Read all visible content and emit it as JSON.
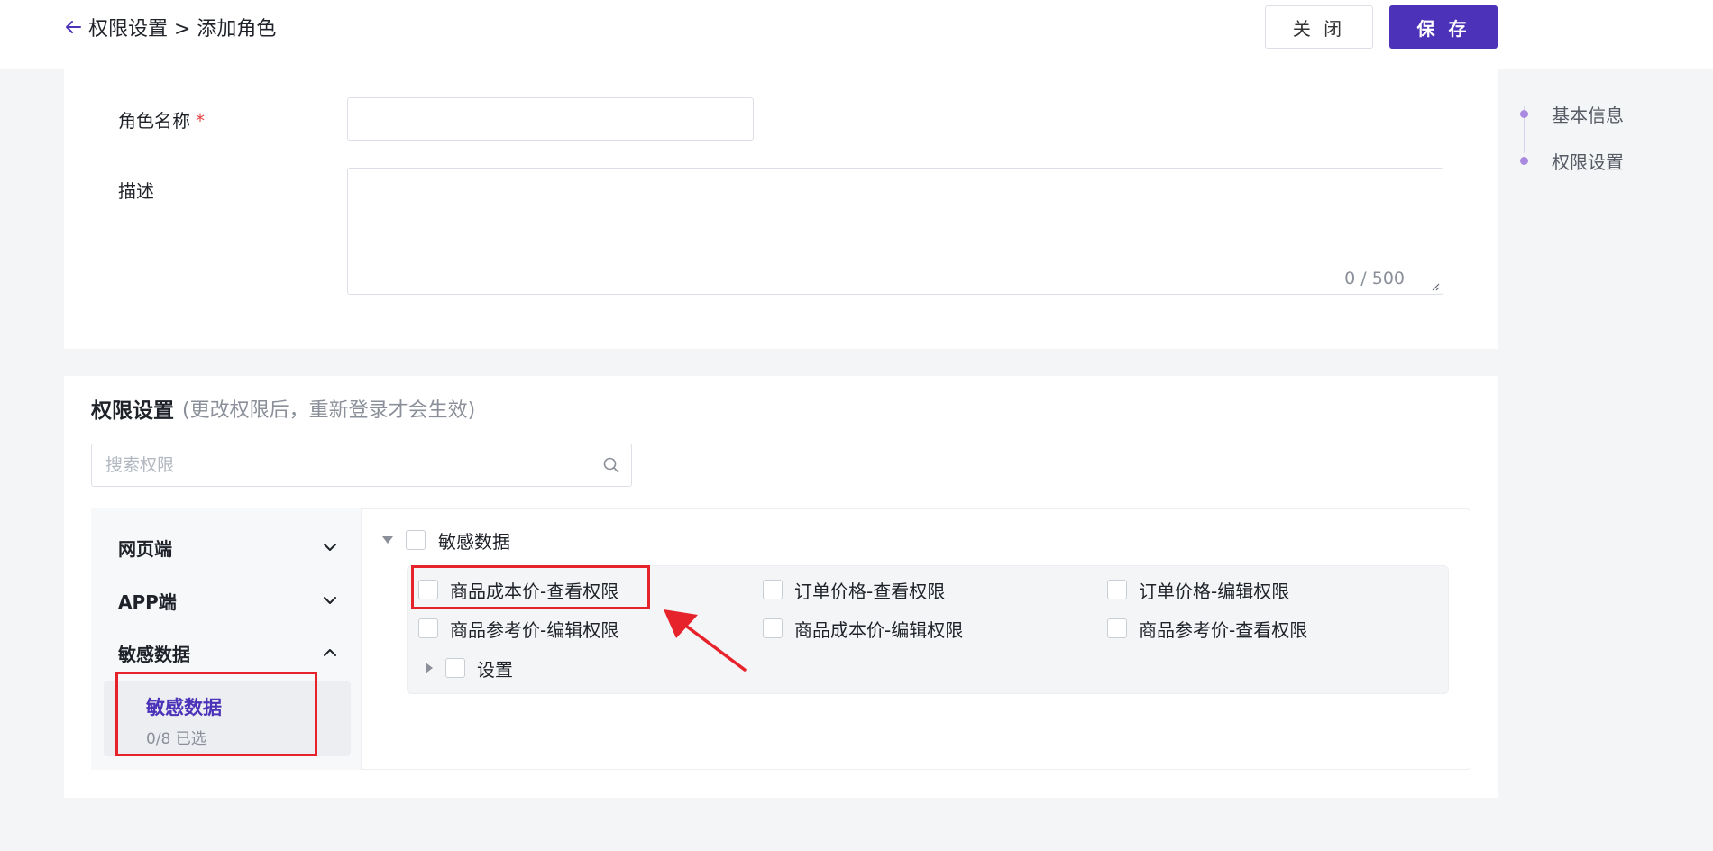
{
  "header": {
    "breadcrumb": "权限设置 > 添加角色",
    "close_label": "关 闭",
    "save_label": "保 存"
  },
  "basic": {
    "name_label": "角色名称",
    "required_mark": "*",
    "name_value": "",
    "desc_label": "描述",
    "desc_value": "",
    "desc_counter": "0 / 500"
  },
  "anchors": [
    "基本信息",
    "权限设置"
  ],
  "permissions": {
    "title": "权限设置",
    "hint": "(更改权限后，重新登录才会生效)",
    "search_placeholder": "搜索权限",
    "sidebar": {
      "groups": [
        {
          "label": "网页端",
          "expanded": false,
          "icon": "chevron-down-icon"
        },
        {
          "label": "APP端",
          "expanded": false,
          "icon": "chevron-down-icon"
        },
        {
          "label": "敏感数据",
          "expanded": true,
          "icon": "chevron-up-icon"
        }
      ],
      "active_item": {
        "label": "敏感数据",
        "count": "0/8 已选"
      }
    },
    "tree": {
      "root_label": "敏感数据",
      "items": [
        "商品成本价-查看权限",
        "订单价格-查看权限",
        "订单价格-编辑权限",
        "商品参考价-编辑权限",
        "商品成本价-编辑权限",
        "商品参考价-查看权限"
      ],
      "child_group": "设置"
    }
  },
  "colors": {
    "primary": "#4b32b8",
    "annotation": "#e6222b",
    "anchor_dot": "#a98ae0"
  }
}
